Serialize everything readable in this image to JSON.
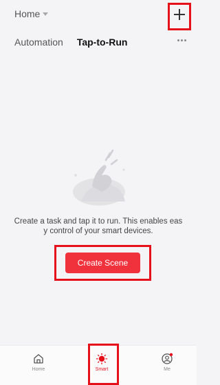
{
  "header": {
    "home_label": "Home",
    "add_icon": "plus-icon"
  },
  "tabs": [
    {
      "label": "Automation",
      "active": false
    },
    {
      "label": "Tap-to-Run",
      "active": true
    }
  ],
  "empty_state": {
    "message": "Create a task and tap it to run. This enables eas y control of your smart devices.",
    "button_label": "Create Scene",
    "illustration": "tap-hand-illustration"
  },
  "bottom_nav": [
    {
      "label": "Home",
      "icon": "home-icon",
      "active": false
    },
    {
      "label": "Smart",
      "icon": "smart-sun-icon",
      "active": true
    },
    {
      "label": "Me",
      "icon": "user-icon",
      "active": false
    }
  ],
  "colors": {
    "accent": "#f0323d",
    "highlight": "#e6101b",
    "background": "#f4f4f6"
  }
}
